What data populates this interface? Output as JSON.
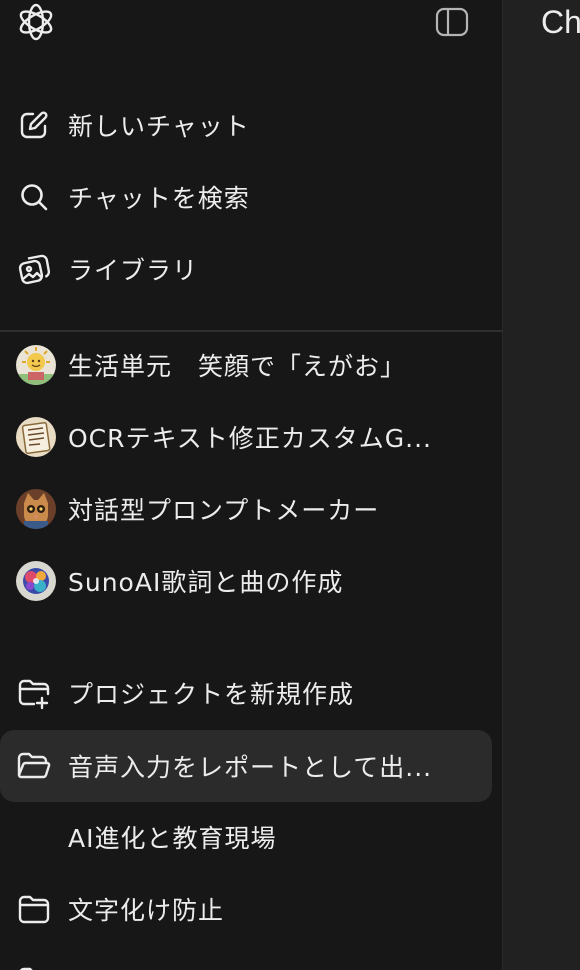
{
  "header": {
    "logo_icon": "openai-logo-icon",
    "toggle_icon": "sidebar-toggle-icon"
  },
  "main": {
    "title": "Ch"
  },
  "nav": {
    "new_chat": "新しいチャット",
    "search_chats": "チャットを検索",
    "library": "ライブラリ"
  },
  "gpts": [
    {
      "label": "生活単元　笑顔で「えがお」",
      "icon": "gpt-avatar-sun-icon"
    },
    {
      "label": "OCRテキスト修正カスタムG...",
      "icon": "gpt-avatar-ocr-icon"
    },
    {
      "label": "対話型プロンプトメーカー",
      "icon": "gpt-avatar-cat-icon"
    },
    {
      "label": "SunoAI歌詞と曲の作成",
      "icon": "gpt-avatar-colorful-icon"
    }
  ],
  "projects": {
    "new_project": "プロジェクトを新規作成",
    "items": [
      {
        "label": "音声入力をレポートとして出...",
        "active": true
      },
      {
        "label": "AI進化と教育現場",
        "active": false
      },
      {
        "label": "文字化け防止",
        "active": false
      }
    ]
  },
  "colors": {
    "sidebar_bg": "#171717",
    "main_bg": "#212121",
    "active_bg": "#2b2b2b",
    "text": "#ececec"
  }
}
